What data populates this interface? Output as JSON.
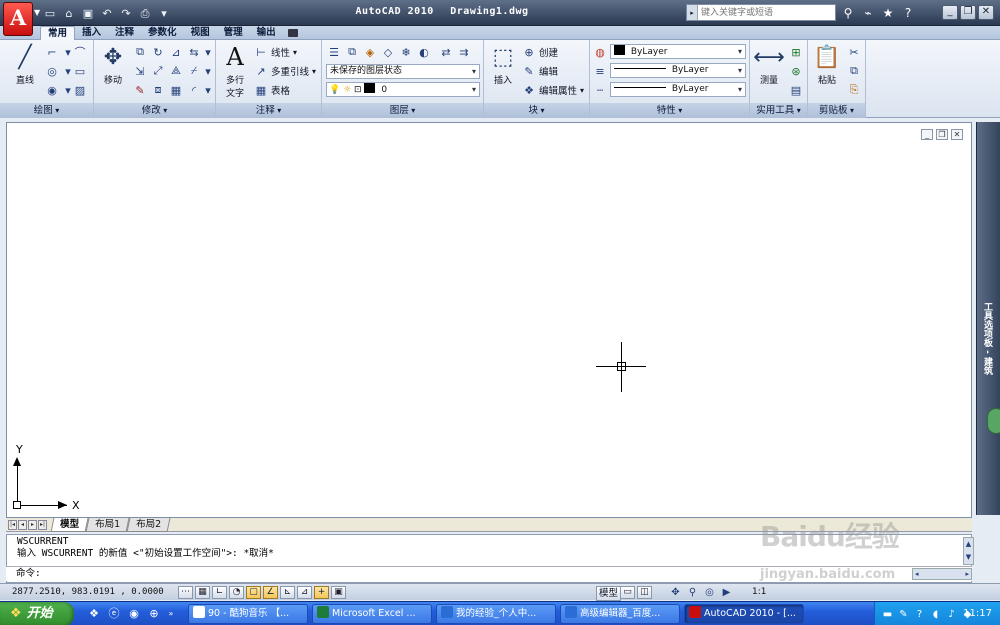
{
  "titlebar": {
    "app_logo": "A",
    "app_name": "AutoCAD 2010",
    "document": "Drawing1.dwg",
    "search_placeholder": "键入关键字或短语"
  },
  "ribbon_tabs": [
    {
      "label": "常用",
      "active": true
    },
    {
      "label": "插入"
    },
    {
      "label": "注释"
    },
    {
      "label": "参数化"
    },
    {
      "label": "视图"
    },
    {
      "label": "管理"
    },
    {
      "label": "输出"
    }
  ],
  "panels": {
    "draw": {
      "title": "绘图",
      "line": "直线"
    },
    "modify": {
      "title": "修改",
      "move": "移动"
    },
    "annotation": {
      "title": "注释",
      "mtext_line1": "多行",
      "mtext_line2": "文字",
      "linear": "线性",
      "multileader": "多重引线",
      "table": "表格"
    },
    "layers": {
      "title": "图层",
      "layer_state": "未保存的图层状态",
      "current_layer": "0"
    },
    "block": {
      "title": "块",
      "insert": "插入",
      "create": "创建",
      "edit": "编辑",
      "edit_attributes": "编辑属性"
    },
    "properties": {
      "title": "特性",
      "color": "ByLayer",
      "linetype": "ByLayer",
      "lineweight": "ByLayer"
    },
    "utilities": {
      "title": "实用工具",
      "measure": "测量"
    },
    "clipboard": {
      "title": "剪贴板",
      "paste": "粘贴"
    }
  },
  "tool_palette_label": "工具选项板 - 建筑",
  "ucs": {
    "x_label": "X",
    "y_label": "Y"
  },
  "layout_tabs": [
    {
      "label": "模型",
      "active": true
    },
    {
      "label": "布局1"
    },
    {
      "label": "布局2"
    }
  ],
  "command": {
    "history_line1": "WSCURRENT",
    "history_line2": "输入 WSCURRENT 的新值 <\"初始设置工作空间\">: *取消*",
    "prompt": "命令:"
  },
  "status": {
    "coordinates": "2877.2510, 983.0191 , 0.0000",
    "model_label": "模型",
    "scale_label": "1:1"
  },
  "watermark": {
    "text": "Baidu经验",
    "subtext": "jingyan.baidu.com"
  },
  "taskbar": {
    "start_label": "开始",
    "tasks": [
      {
        "label": "90 - 酷狗音乐 【...",
        "active": false
      },
      {
        "label": "Microsoft Excel ...",
        "active": false
      },
      {
        "label": "我的经验_个人中...",
        "active": false
      },
      {
        "label": "高级编辑器_百度...",
        "active": false
      },
      {
        "label": "AutoCAD 2010 - [...",
        "active": true
      }
    ],
    "clock": "11:17"
  },
  "colors": {
    "accent": "#245edb",
    "autocad_red": "#c80e0e"
  }
}
